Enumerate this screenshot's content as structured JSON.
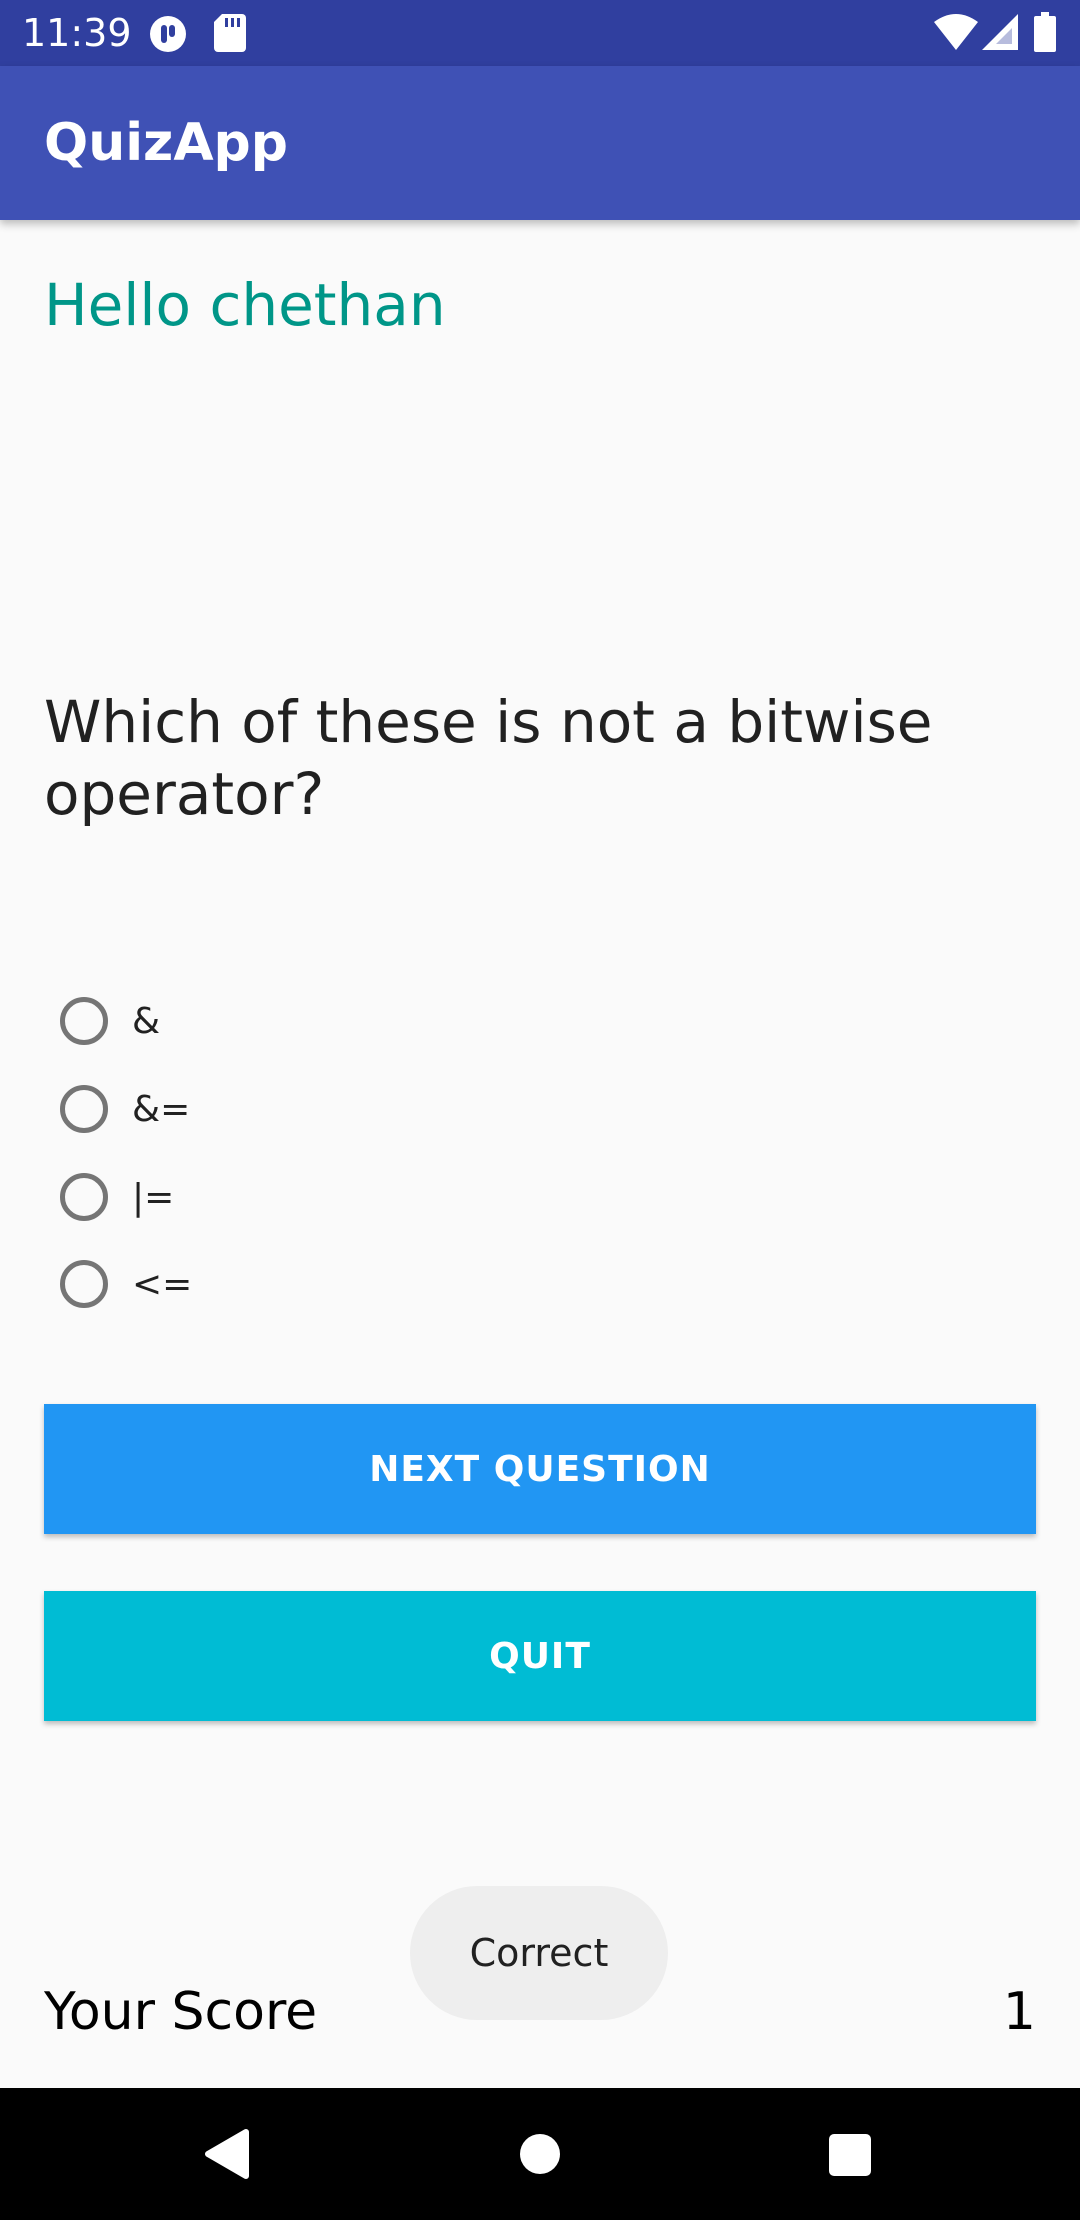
{
  "status_bar": {
    "time": "11:39",
    "icons": [
      "pocket-icon",
      "sd-card-icon",
      "wifi-icon",
      "signal-icon",
      "battery-icon"
    ]
  },
  "app_bar": {
    "title": "QuizApp",
    "color": "#3f51b5"
  },
  "greeting": "Hello chethan",
  "question": "Which of these is not a bitwise operator?",
  "options": [
    "&",
    "&=",
    "|=",
    "<="
  ],
  "buttons": {
    "next_label": "NEXT QUESTION",
    "quit_label": "QUIT"
  },
  "score": {
    "label": "Your Score",
    "value": "1"
  },
  "toast": "Correct",
  "nav_bar": {
    "icons": [
      "back-icon",
      "home-icon",
      "recents-icon"
    ]
  },
  "colors": {
    "status_bar": "#303f9f",
    "greeting": "#009688",
    "next_button": "#2196f3",
    "quit_button": "#00bcd4"
  }
}
